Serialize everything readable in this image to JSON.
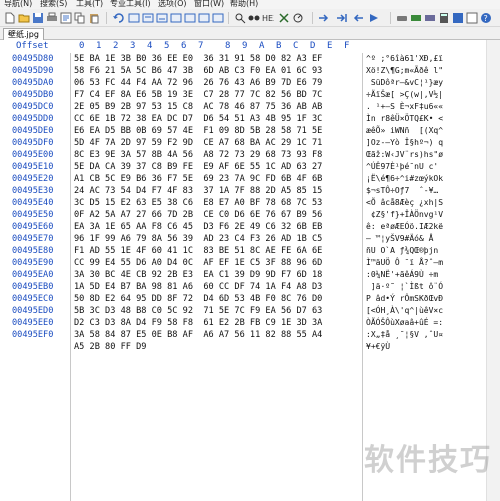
{
  "menubar": {
    "items": [
      "导航(N)",
      "搜索(S)",
      "工具(T)",
      "专业工具(I)",
      "选项(O)",
      "窗口(W)",
      "帮助(H)"
    ]
  },
  "toolbar": {
    "icons": [
      "new-file-icon",
      "open-file-icon",
      "save-icon",
      "print-icon",
      "properties-icon",
      "undo-icon",
      "copy-icon",
      "paste-icon",
      "cut-icon",
      "find-icon",
      "find-replace-icon",
      "find-next-icon",
      "goto-icon",
      "back-icon",
      "forward-icon",
      "disk-icon",
      "ram-icon",
      "calculator-icon",
      "hash-icon",
      "help-icon"
    ]
  },
  "tab": {
    "label": "壁纸.jpg"
  },
  "header": {
    "offset_label": "Offset",
    "columns": [
      "0",
      "1",
      "2",
      "3",
      "4",
      "5",
      "6",
      "7",
      "8",
      "9",
      "A",
      "B",
      "C",
      "D",
      "E",
      "F"
    ]
  },
  "rows": [
    {
      "offset": "00495D80",
      "hex": "5E BA 1E 3B B0 36 EE E0  36 31 91 58 D0 82 A3 EF",
      "ascii": "^º ;°6îà61'XÐ‚£ï"
    },
    {
      "offset": "00495D90",
      "hex": "58 F6 21 5A 5C B6 47 3B  6D AB C3 F0 EA 01 6C 93",
      "ascii": "Xö!Z\\¶G;m«Ãðê l\""
    },
    {
      "offset": "00495DA0",
      "hex": "06 53 FC 44 F4 AA 72 96  26 76 43 A6 B9 7D E6 79",
      "ascii": " SüDôªr–&vC¦¹}æy"
    },
    {
      "offset": "00495DB0",
      "hex": "F7 C4 EF 8A E6 5B 19 3E  C7 28 77 7C 82 56 BD 7C",
      "ascii": "÷ÄïŠæ[ >Ç(w|‚V½|"
    },
    {
      "offset": "00495DC0",
      "hex": "2E 05 B9 2B 97 53 15 C8  AC 78 46 87 75 36 AB AB",
      "ascii": ". ¹+—S È¬xF‡u6««"
    },
    {
      "offset": "00495DD0",
      "hex": "CC 6E 1B 72 38 EA DC D7  D6 54 51 A3 4B 95 1F 3C",
      "ascii": "Ìn r8êÜ×ÖTQ£K• <"
    },
    {
      "offset": "00495DE0",
      "hex": "E6 EA D5 BB 0B 69 57 4E  F1 09 8D 5B 28 58 71 5E",
      "ascii": "æêÕ» iWNñ  [(Xq^"
    },
    {
      "offset": "00495DF0",
      "hex": "5D 4F 7A 2D 97 59 F2 9D  CE A7 68 BA AC 29 1C 71",
      "ascii": "]Oz-—Yò Î§hº¬) q"
    },
    {
      "offset": "00495E00",
      "hex": "8C E3 9E 3A 57 8B 4A 56  A8 72 73 29 68 73 93 F8",
      "ascii": "Œãž:W‹JV¨rs)hs\"ø"
    },
    {
      "offset": "00495E10",
      "hex": "5E DA CA 39 37 C8 B9 FE  E9 AF 6E 55 1C AD 63 27",
      "ascii": "^ÚÊ97È¹þé¯nU ­c'"
    },
    {
      "offset": "00495E20",
      "hex": "A1 CB 5C E9 B6 36 F7 5E  69 23 7A 9C FD 6B 4F 6B",
      "ascii": "¡Ë\\é¶6÷^i#zœýkOk"
    },
    {
      "offset": "00495E30",
      "hex": "24 AC 73 54 D4 F7 4F 83  37 1A 7F 88 2D A5 85 15",
      "ascii": "$¬sTÔ÷Oƒ7  ˆ-¥… "
    },
    {
      "offset": "00495E40",
      "hex": "3C D5 15 E2 63 E5 38 C6  E8 E7 A0 BF 78 68 7C 53",
      "ascii": "<Õ âcå8Æèç ¿xh|S"
    },
    {
      "offset": "00495E50",
      "hex": "0F A2 5A A7 27 66 7D 2B  CE C0 D6 6E 76 67 B9 56",
      "ascii": " ¢Z§'f}+ÎÀÖnvg¹V"
    },
    {
      "offset": "00495E60",
      "hex": "EA 3A 1E 65 AA F8 C6 45  D3 F6 2E 49 C6 32 6B EB",
      "ascii": "ê: eªøÆEÓö.IÆ2kë"
    },
    {
      "offset": "00495E70",
      "hex": "96 1F 99 A6 79 8A 56 39  AD 23 C4 F3 26 AD 1B C5",
      "ascii": "– ™¦yŠV9­#Äó&­ Å"
    },
    {
      "offset": "00495E80",
      "hex": "F1 AD 55 1E 4F 60 41 1C  83 BE 51 8C AE FE 6A 6E",
      "ascii": "ñ­U O`A ƒ¾QŒ®þjn"
    },
    {
      "offset": "00495E90",
      "hex": "CC 99 E4 55 D6 A0 D4 0C  AF EF 1E C5 3F 88 96 6D",
      "ascii": "Ì™äUÖ Ô ¯ï Å?ˆ–m"
    },
    {
      "offset": "00495EA0",
      "hex": "3A 30 BC 4E CB 92 2B E3  EA C1 39 D9 9D F7 6D 18",
      "ascii": ":0¼NË'+ãêÁ9Ù ÷m "
    },
    {
      "offset": "00495EB0",
      "hex": "1A 5D E4 B7 BA 98 81 A6  60 CC DF 74 1A F4 A8 D3",
      "ascii": " ]ä·º˜ ¦`Ìßt ô¨Ó"
    },
    {
      "offset": "00495EC0",
      "hex": "50 8D E2 64 95 DD 8F 72  D4 6D 53 4B F0 8C 76 D0",
      "ascii": "P âd•Ý rÔmSKðŒvÐ"
    },
    {
      "offset": "00495ED0",
      "hex": "5B 3C D3 48 B8 C0 5C 92  71 5E 7C F9 EA 56 D7 63",
      "ascii": "[<ÓH¸À\\'q^|ùêV×c"
    },
    {
      "offset": "00495EE0",
      "hex": "D2 C3 D3 8A D4 F9 58 F8  61 E2 2B FB C9 1E 3D 3A",
      "ascii": "ÒÃÓŠÔùXøaâ+ûÉ =:"
    },
    {
      "offset": "00495EF0",
      "hex": "3A 58 84 87 E5 0E B8 AF  A6 A7 56 11 82 88 55 A4",
      "ascii": ":X„‡å ¸¯¦§V ‚ˆU¤"
    },
    {
      "offset": "",
      "hex": "A5 2B 80 FF D9",
      "ascii": "¥+€ÿÙ"
    }
  ],
  "watermark": "软件技巧"
}
